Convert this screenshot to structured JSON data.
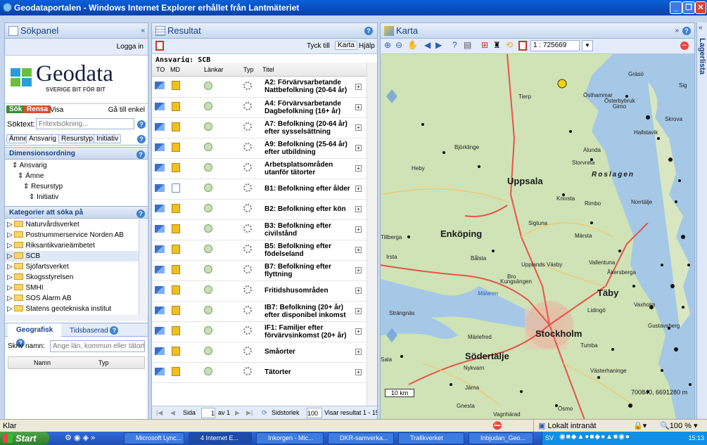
{
  "window": {
    "title": "Geodataportalen - Windows Internet Explorer erhållet från Lantmäteriet"
  },
  "search": {
    "title": "Sökpanel",
    "login": "Logga in",
    "logo_text": "Geodata",
    "logo_sub": "SVERIGE BIT FÖR BIT",
    "tab_sok": "Sök",
    "tab_rensa": "Rensa",
    "tab_visa": "Visa",
    "goto_simple": "Gå till enkel",
    "searchtext_label": "Söktext:",
    "searchtext_placeholder": "Fritextsökning...",
    "facets": [
      "Ämne",
      "Ansvarig",
      "Resurstyp",
      "Initiativ"
    ],
    "dim_title": "Dimensionsordning",
    "dims": [
      "Ansvarig",
      "Ämne",
      "Resurstyp",
      "Initiativ"
    ],
    "cat_title": "Kategorier att söka på",
    "categories": [
      "Naturvårdsverket",
      "Postnummerservice Norden AB",
      "Riksantikvarieämbetet",
      "SCB",
      "Sjöfartsverket",
      "Skogsstyrelsen",
      "SMHI",
      "SOS Alarm AB",
      "Statens geotekniska institut"
    ],
    "geo_tab": "Geografisk",
    "time_tab": "Tidsbaserad",
    "name_label": "Skriv namn:",
    "name_placeholder": "Ange län, kommun eller tätort",
    "col_name": "Namn",
    "col_type": "Typ"
  },
  "result": {
    "title": "Resultat",
    "feedback": "Tyck till",
    "map_btn": "Karta",
    "help": "Hjälp",
    "responsible": "Ansvarig: SCB",
    "cols": {
      "to": "TO",
      "md": "MD",
      "links": "Länkar",
      "type": "Typ",
      "title": "Titel"
    },
    "rows": [
      {
        "title": "A2: Förvärvsarbetande Nattbefolkning (20-64 år)",
        "md": "y"
      },
      {
        "title": "A4: Förvärvsarbetande Dagbefolkning (16+ år)",
        "md": "y"
      },
      {
        "title": "A7: Befolkning (20-64 år) efter sysselsättning",
        "md": "y"
      },
      {
        "title": "A9: Befolkning (25-64 år) efter utbildning",
        "md": "y"
      },
      {
        "title": "Arbetsplatsområden utanför tätorter",
        "md": "y"
      },
      {
        "title": "B1: Befolkning efter ålder",
        "md": "d"
      },
      {
        "title": "B2: Befolkning efter kön",
        "md": "y"
      },
      {
        "title": "B3: Befolkning efter civilstånd",
        "md": "y"
      },
      {
        "title": "B5: Befolkning efter födelseland",
        "md": "y"
      },
      {
        "title": "B7: Befolkning efter flyttning",
        "md": "y"
      },
      {
        "title": "Fritidshusområden",
        "md": "y"
      },
      {
        "title": "IB7: Befolkning (20+ år) efter disponibel inkomst",
        "md": "y"
      },
      {
        "title": "IF1: Familjer efter förvärvsinkomst (20+ år)",
        "md": "y"
      },
      {
        "title": "Småorter",
        "md": "y"
      },
      {
        "title": "Tätorter",
        "md": "y"
      }
    ],
    "pager": {
      "page_label": "Sida",
      "page": "1",
      "of": "av 1",
      "size_label": "Sidstorlek",
      "size": "100",
      "summary": "Visar resultat 1 - 15"
    }
  },
  "map": {
    "title": "Karta",
    "scale": "1 : 725669",
    "scalebar": "10 km",
    "coords": "700840, 6691280 m",
    "places": [
      "Tierp",
      "Östhammar",
      "Gräsö",
      "Österbybruk",
      "Gimo",
      "Björklinge",
      "Alunda",
      "Hallstavik",
      "Heby",
      "Storvreta",
      "Roslagen",
      "Uppsala",
      "Enköping",
      "Sigtuna",
      "Märsta",
      "Rimbo",
      "Norrtälje",
      "Bålsta",
      "Upplands Väsby",
      "Vallentuna",
      "Åkersberga",
      "Täby",
      "Lidingö",
      "Stockholm",
      "Södertälje",
      "Tumba",
      "Nykvarn",
      "Strängnäs",
      "Märiefred",
      "Vaxholm",
      "Gustavsberg",
      "Västerhaninge",
      "Järna",
      "Gnesta",
      "Vagnhärad",
      "Ösmo",
      "Tillberga",
      "Irsta",
      "Bro",
      "Kungsängen",
      "Mälaren",
      "Sala",
      "Knivsta",
      "Skrova",
      "Sig"
    ]
  },
  "lager": {
    "title": "Lagerlista"
  },
  "status": {
    "left": "Klar",
    "zone": "Lokalt intranät",
    "zoom": "100 %"
  },
  "taskbar": {
    "start": "Start",
    "items": [
      "Microsoft Lync...",
      "4 Internet E...",
      "Inkorgen - Mic...",
      "DKR-samverka...",
      "Trafikverket",
      "Inbjudan_Geo..."
    ],
    "lang": "SV",
    "clock": "15:13"
  }
}
